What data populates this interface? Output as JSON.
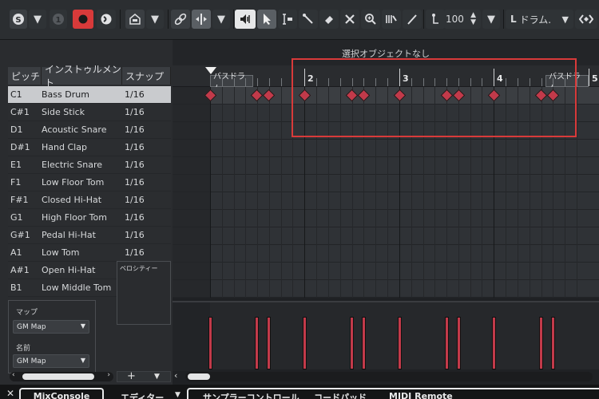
{
  "toolbar": {
    "tempo_value": "100",
    "drum_map_label": "ドラム."
  },
  "info_line": {
    "text": "選択オブジェクトなし"
  },
  "columns": {
    "pitch": "ピッチ",
    "instrument": "インストゥルメント",
    "snap": "スナップ"
  },
  "instruments": [
    {
      "pitch": "C1",
      "name": "Bass Drum",
      "snap": "1/16"
    },
    {
      "pitch": "C#1",
      "name": "Side Stick",
      "snap": "1/16"
    },
    {
      "pitch": "D1",
      "name": "Acoustic Snare",
      "snap": "1/16"
    },
    {
      "pitch": "D#1",
      "name": "Hand Clap",
      "snap": "1/16"
    },
    {
      "pitch": "E1",
      "name": "Electric Snare",
      "snap": "1/16"
    },
    {
      "pitch": "F1",
      "name": "Low Floor Tom",
      "snap": "1/16"
    },
    {
      "pitch": "F#1",
      "name": "Closed Hi-Hat",
      "snap": "1/16"
    },
    {
      "pitch": "G1",
      "name": "High Floor Tom",
      "snap": "1/16"
    },
    {
      "pitch": "G#1",
      "name": "Pedal Hi-Hat",
      "snap": "1/16"
    },
    {
      "pitch": "A1",
      "name": "Low Tom",
      "snap": "1/16"
    },
    {
      "pitch": "A#1",
      "name": "Open Hi-Hat",
      "snap": "1/16"
    },
    {
      "pitch": "B1",
      "name": "Low Middle Tom",
      "snap": "1/16"
    }
  ],
  "map_section": {
    "map_label": "マップ",
    "map_value": "GM Map",
    "name_label": "名前",
    "name_value": "GM Map"
  },
  "velocity_label": "ベロシティー",
  "ruler": {
    "bars": [
      "2",
      "3",
      "4",
      "5"
    ],
    "markers": [
      "バスドラム",
      "バスドラム"
    ]
  },
  "bass_drum_note_count": 12,
  "bottom_tabs": {
    "mixconsole": "MixConsole",
    "editor": "エディター",
    "sampler": "サンプラーコントロール",
    "chordpad": "コードパッド",
    "midiremote": "MIDI Remote"
  },
  "colors": {
    "note": "#c23a4a",
    "highlight_rect": "#d83a3a",
    "record": "#e03a3a"
  }
}
